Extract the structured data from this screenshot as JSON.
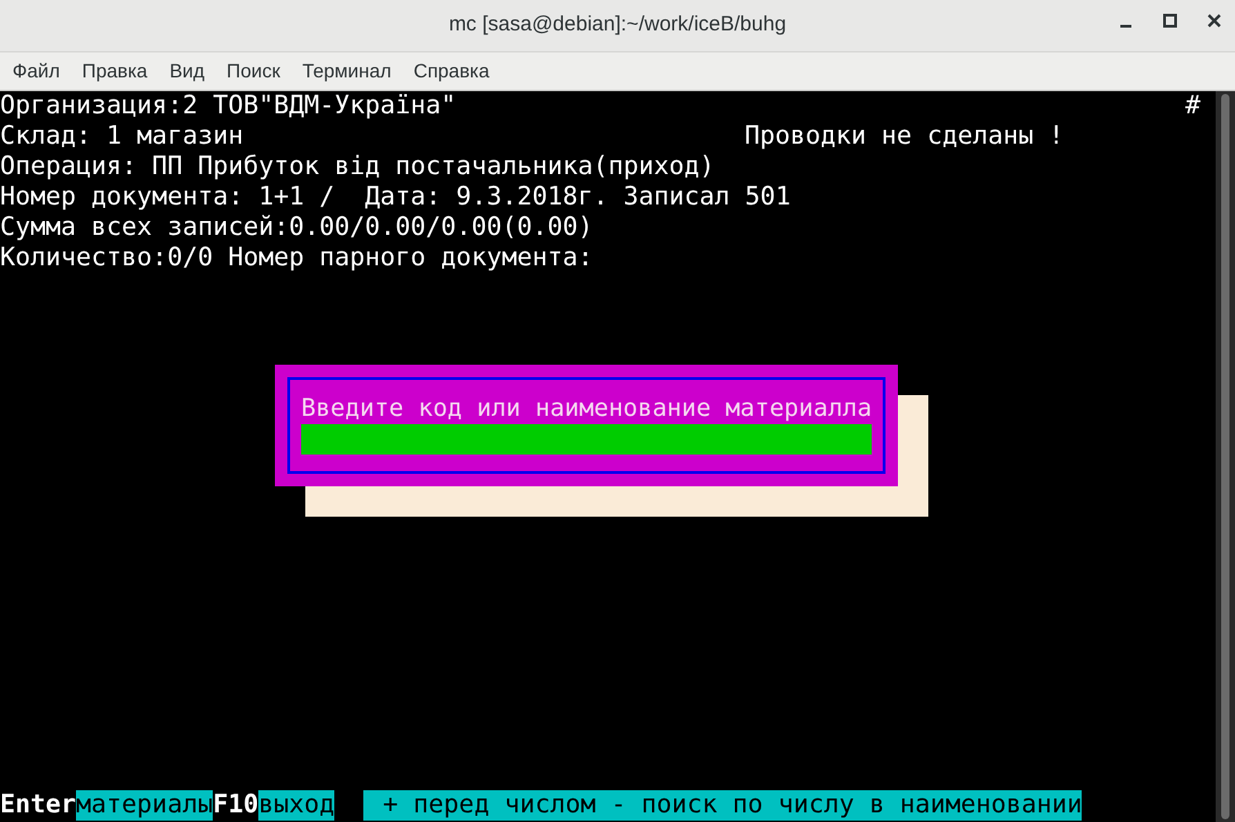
{
  "window": {
    "title": "mc [sasa@debian]:~/work/iceB/buhg"
  },
  "menu": [
    "Файл",
    "Правка",
    "Вид",
    "Поиск",
    "Терминал",
    "Справка"
  ],
  "header_lines": [
    {
      "left": "Организация:2 ТОВ\"ВДМ-Україна\"",
      "right": "#"
    },
    {
      "left": "Склад: 1 магазин",
      "right": "Проводки не сделаны !"
    },
    {
      "left": "Операция: ПП Прибуток від постачальника(приход)"
    },
    {
      "left": "Номер документа: 1+1 /  Дата: 9.3.2018г. Записал 501"
    },
    {
      "left": "Сумма всех записей:0.00/0.00/0.00(0.00)"
    },
    {
      "left": "Количество:0/0 Номер парного документа:"
    }
  ],
  "dialog": {
    "prompt": "Введите код или наименование материалла"
  },
  "key_bar": [
    {
      "key": "Enter",
      "action": "материалы"
    },
    {
      "key": "F10",
      "action": "выход"
    }
  ],
  "hint": "+ перед числом - поиск по числу в наименовании"
}
